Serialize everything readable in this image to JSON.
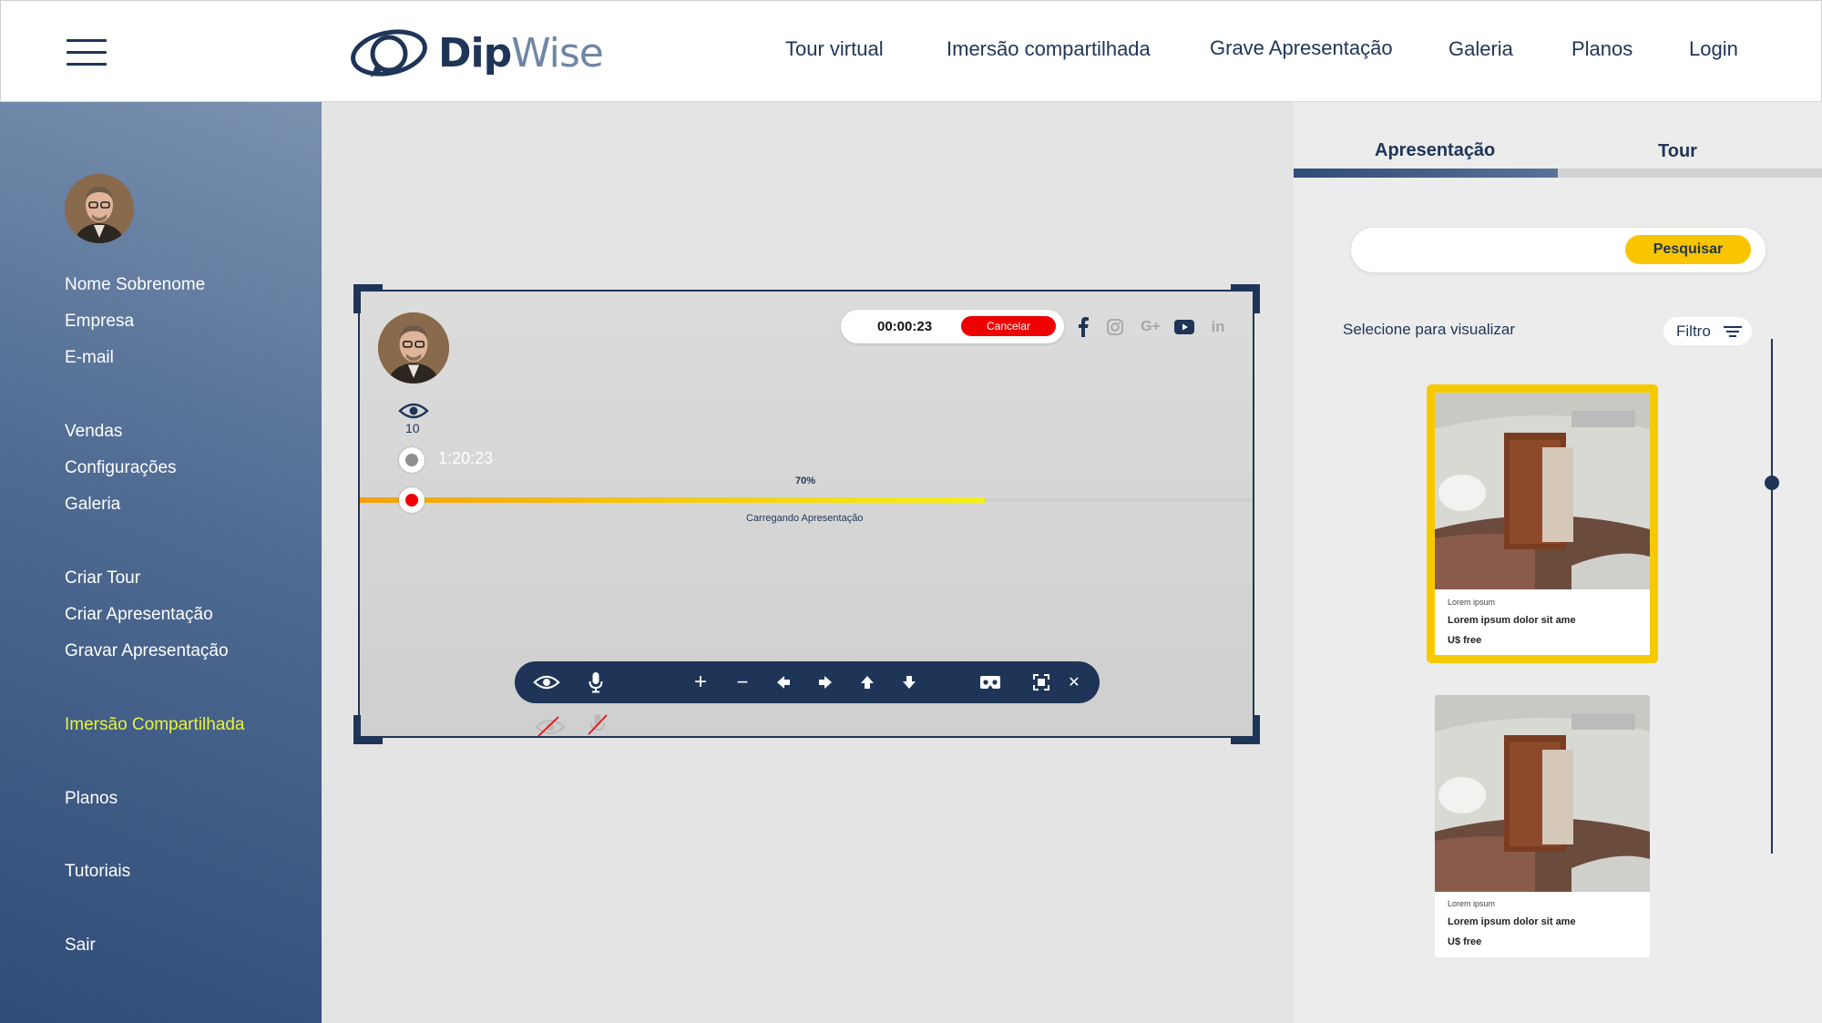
{
  "header": {
    "logo_prefix": "Dip",
    "logo_suffix": "Wise",
    "nav": [
      "Tour virtual",
      "Imersão compartilhada",
      "Grave Apresentação",
      "Galeria",
      "Planos",
      "Login"
    ]
  },
  "sidebar": {
    "user_name": "Nome Sobrenome",
    "company": "Empresa",
    "email": "E-mail",
    "items": [
      "Vendas",
      "Configurações",
      "Galeria",
      "Criar Tour",
      "Criar Apresentação",
      "Gravar Apresentação",
      "Imersão Compartilhada",
      "Planos",
      "Tutoriais",
      "Sair"
    ],
    "active_item": "Imersão Compartilhada"
  },
  "recording": {
    "timer": "00:00:23",
    "cancel_label": "Cancelar",
    "viewers": "10",
    "duration": "1:20:23",
    "progress_label": "70%",
    "progress_fraction": 0.7,
    "loading_text": "Carregando Apresentação",
    "social_icons": [
      "facebook-icon",
      "instagram-icon",
      "google-plus-icon",
      "youtube-icon",
      "linkedin-icon"
    ],
    "social_google_plus": "G+",
    "social_linkedin": "in",
    "toolbar_icons": [
      "eye-icon",
      "microphone-icon",
      "plus-icon",
      "minus-icon",
      "arrow-left-icon",
      "arrow-right-icon",
      "arrow-up-icon",
      "arrow-down-icon",
      "vr-glasses-icon",
      "fullscreen-icon",
      "close-icon"
    ],
    "toolbar_plus": "+",
    "toolbar_minus": "−",
    "toolbar_close": "✕"
  },
  "panel": {
    "tabs": [
      "Apresentação",
      "Tour"
    ],
    "active_tab": "Apresentação",
    "search_placeholder": "",
    "search_button": "Pesquisar",
    "select_label": "Selecione para visualizar",
    "filter_label": "Filtro",
    "cards": [
      {
        "small": "Lorem ipsum",
        "title": "Lorem ipsum dolor sit ame",
        "price": "U$ free",
        "selected": true
      },
      {
        "small": "Lorem ipsum",
        "title": "Lorem ipsum dolor sit ame",
        "price": "U$ free",
        "selected": false
      }
    ]
  },
  "colors": {
    "brand": "#1e3557",
    "accent_yellow": "#f9c400",
    "active_menu": "#e9f33a",
    "danger": "#ee0000"
  }
}
